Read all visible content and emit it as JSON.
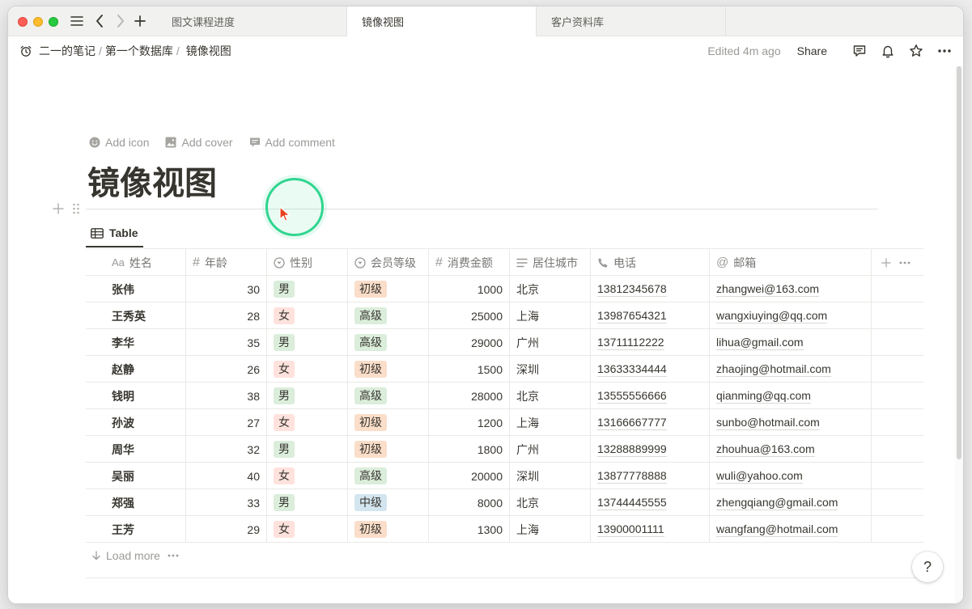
{
  "tabs": [
    {
      "label": "图文课程进度"
    },
    {
      "label": "镜像视图"
    },
    {
      "label": "客户资料库"
    }
  ],
  "breadcrumb": {
    "items": [
      "二一的笔记",
      "第一个数据库",
      "镜像视图"
    ],
    "sep": "/"
  },
  "topbar": {
    "edited": "Edited 4m ago",
    "share": "Share"
  },
  "page": {
    "add_icon": "Add icon",
    "add_cover": "Add cover",
    "add_comment": "Add comment",
    "title": "镜像视图"
  },
  "view": {
    "tab_label": "Table"
  },
  "columns": [
    {
      "icon": "text-icon",
      "label": "姓名"
    },
    {
      "icon": "number-icon",
      "label": "年龄"
    },
    {
      "icon": "select-icon",
      "label": "性别"
    },
    {
      "icon": "select-icon",
      "label": "会员等级"
    },
    {
      "icon": "number-icon",
      "label": "消费金额"
    },
    {
      "icon": "lines-icon",
      "label": "居住城市"
    },
    {
      "icon": "phone-icon",
      "label": "电话"
    },
    {
      "icon": "at-icon",
      "label": "邮箱"
    }
  ],
  "header_icon_text": {
    "text": "Aa",
    "number": "#",
    "at": "@"
  },
  "rows": [
    {
      "name": "张伟",
      "age": "30",
      "gender": "男",
      "level": "初级",
      "amount": "1000",
      "city": "北京",
      "phone": "13812345678",
      "email": "zhangwei@163.com"
    },
    {
      "name": "王秀英",
      "age": "28",
      "gender": "女",
      "level": "高级",
      "amount": "25000",
      "city": "上海",
      "phone": "13987654321",
      "email": "wangxiuying@qq.com"
    },
    {
      "name": "李华",
      "age": "35",
      "gender": "男",
      "level": "高级",
      "amount": "29000",
      "city": "广州",
      "phone": "13711112222",
      "email": "lihua@gmail.com"
    },
    {
      "name": "赵静",
      "age": "26",
      "gender": "女",
      "level": "初级",
      "amount": "1500",
      "city": "深圳",
      "phone": "13633334444",
      "email": "zhaojing@hotmail.com"
    },
    {
      "name": "钱明",
      "age": "38",
      "gender": "男",
      "level": "高级",
      "amount": "28000",
      "city": "北京",
      "phone": "13555556666",
      "email": "qianming@qq.com"
    },
    {
      "name": "孙波",
      "age": "27",
      "gender": "女",
      "level": "初级",
      "amount": "1200",
      "city": "上海",
      "phone": "13166667777",
      "email": "sunbo@hotmail.com"
    },
    {
      "name": "周华",
      "age": "32",
      "gender": "男",
      "level": "初级",
      "amount": "1800",
      "city": "广州",
      "phone": "13288889999",
      "email": "zhouhua@163.com"
    },
    {
      "name": "吴丽",
      "age": "40",
      "gender": "女",
      "level": "高级",
      "amount": "20000",
      "city": "深圳",
      "phone": "13877778888",
      "email": "wuli@yahoo.com"
    },
    {
      "name": "郑强",
      "age": "33",
      "gender": "男",
      "level": "中级",
      "amount": "8000",
      "city": "北京",
      "phone": "13744445555",
      "email": "zhengqiang@gmail.com"
    },
    {
      "name": "王芳",
      "age": "29",
      "gender": "女",
      "level": "初级",
      "amount": "1300",
      "city": "上海",
      "phone": "13900001111",
      "email": "wangfang@hotmail.com"
    }
  ],
  "tag_colors": {
    "男": "#dbeddb",
    "女": "#ffe2dd",
    "初级": "#fadec9",
    "高级": "#dbeddb",
    "中级": "#d3e5ef"
  },
  "footer": {
    "load_more": "Load more",
    "help": "?"
  },
  "colors": {
    "cursor_ring": "#2fd58f",
    "text": "#37352f",
    "muted": "#9b9a97"
  }
}
